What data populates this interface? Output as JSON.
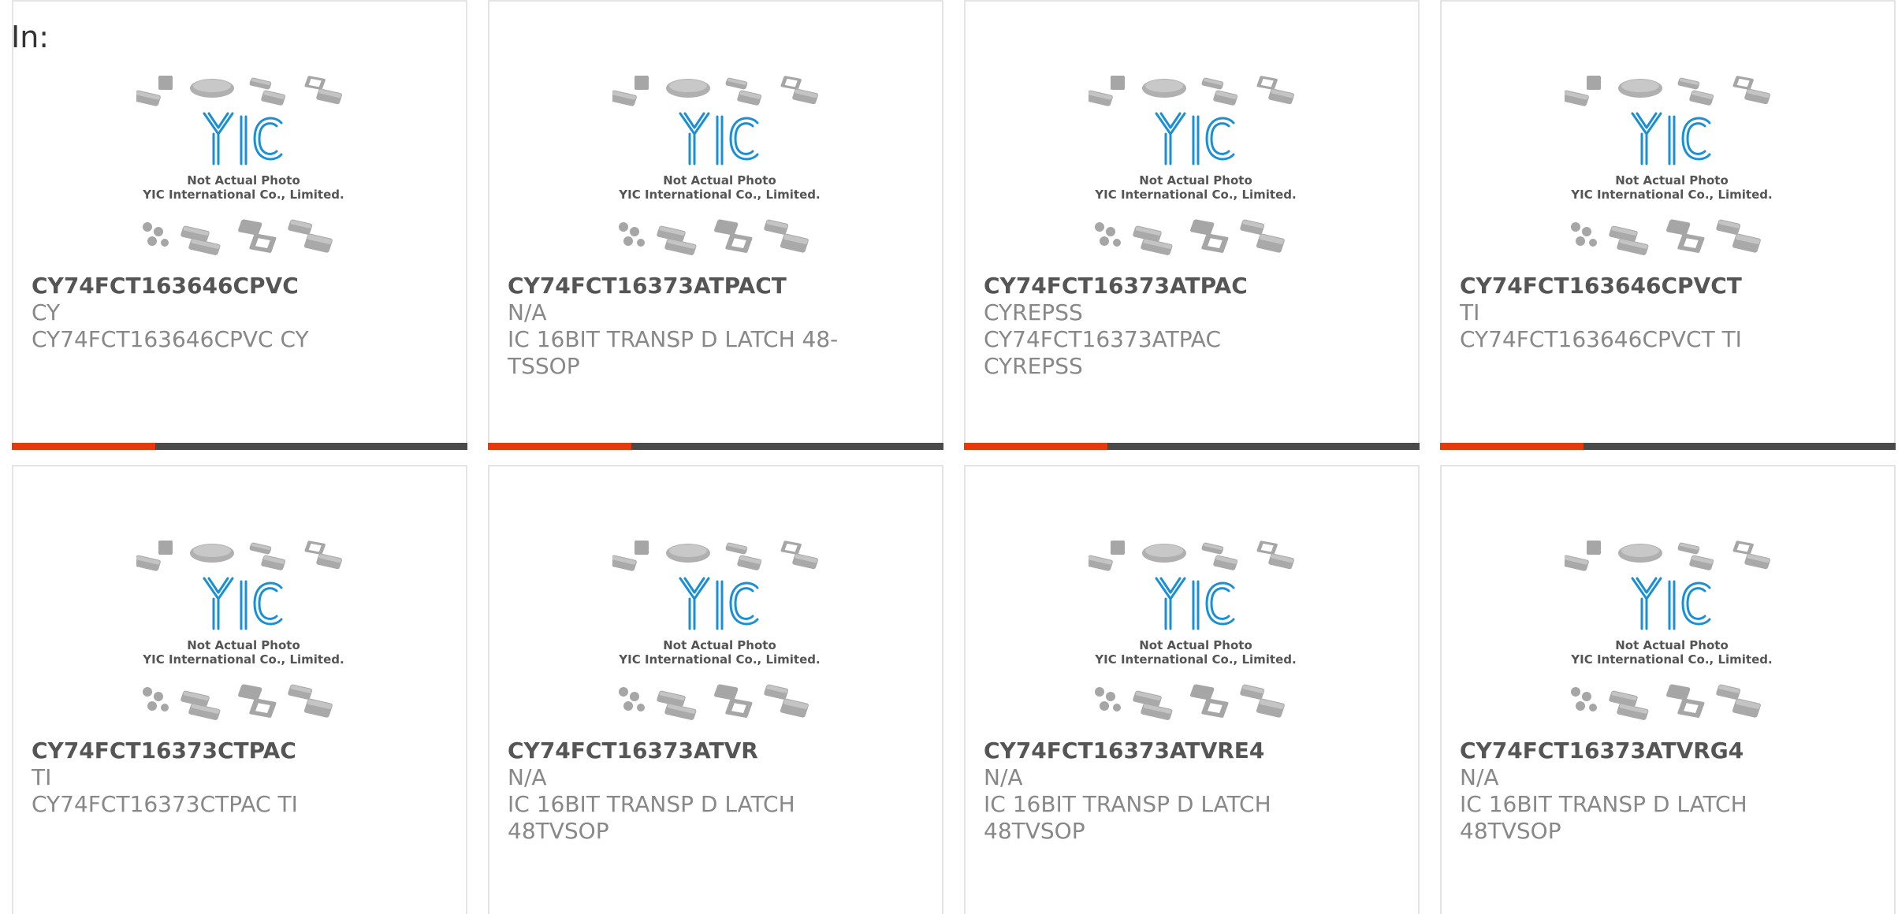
{
  "page": {
    "in_label": "In:"
  },
  "photo": {
    "caption_line1": "Not Actual Photo",
    "caption_line2": "YIC International Co., Limited.",
    "logo_text": "YIC"
  },
  "colors": {
    "accent": "#e8380d",
    "bar": "#4a4a4a",
    "logo_blue": "#1b8fd6",
    "part_number": "#555555",
    "secondary_text": "#888888"
  },
  "products": [
    {
      "part_number": "CY74FCT163646CPVC",
      "manufacturer": "CY",
      "description": "CY74FCT163646CPVC CY"
    },
    {
      "part_number": "CY74FCT16373ATPACT",
      "manufacturer": "N/A",
      "description": "IC 16BIT TRANSP D LATCH 48-TSSOP"
    },
    {
      "part_number": "CY74FCT16373ATPAC",
      "manufacturer": "CYREPSS",
      "description": "CY74FCT16373ATPAC CYREPSS"
    },
    {
      "part_number": "CY74FCT163646CPVCT",
      "manufacturer": "TI",
      "description": "CY74FCT163646CPVCT TI"
    },
    {
      "part_number": "CY74FCT16373CTPAC",
      "manufacturer": "TI",
      "description": "CY74FCT16373CTPAC TI"
    },
    {
      "part_number": "CY74FCT16373ATVR",
      "manufacturer": "N/A",
      "description": "IC 16BIT TRANSP D LATCH 48TVSOP"
    },
    {
      "part_number": "CY74FCT16373ATVRE4",
      "manufacturer": "N/A",
      "description": "IC 16BIT TRANSP D LATCH 48TVSOP"
    },
    {
      "part_number": "CY74FCT16373ATVRG4",
      "manufacturer": "N/A",
      "description": "IC 16BIT TRANSP D LATCH 48TVSOP"
    }
  ]
}
